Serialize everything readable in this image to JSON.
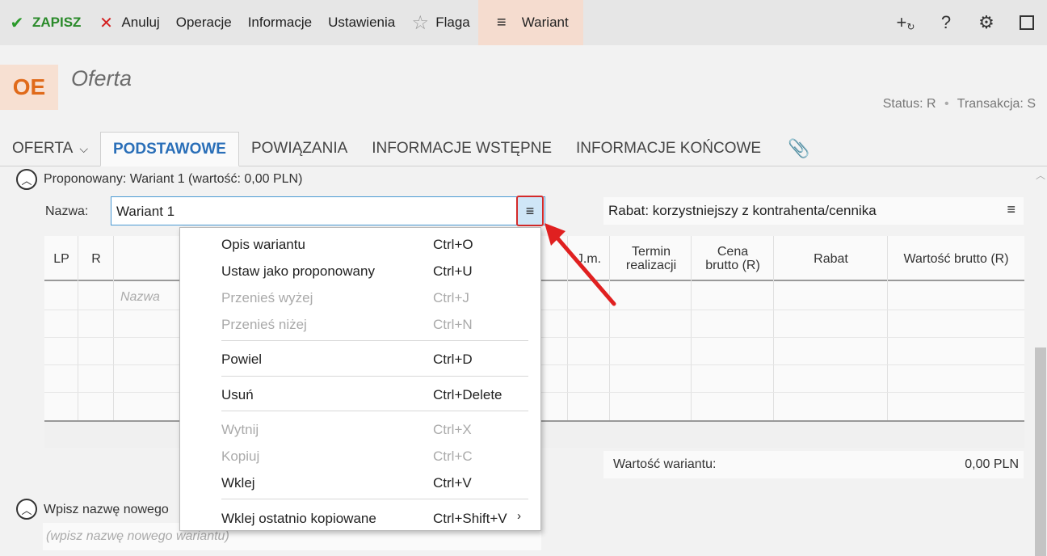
{
  "toolbar": {
    "save": "ZAPISZ",
    "cancel": "Anuluj",
    "operations": "Operacje",
    "info": "Informacje",
    "settings": "Ustawienia",
    "flag": "Flaga",
    "variant": "Wariant",
    "icons": [
      "check-icon",
      "x-icon",
      "star-icon",
      "hamburger-icon",
      "add-refresh-icon",
      "help-icon",
      "gear-icon",
      "maximize-icon"
    ]
  },
  "header": {
    "badge": "OE",
    "title": "Oferta",
    "status_label": "Status:",
    "status_value": "R",
    "transaction_label": "Transakcja:",
    "transaction_value": "S"
  },
  "tabs": [
    "OFERTA",
    "PODSTAWOWE",
    "POWIĄZANIA",
    "INFORMACJE WSTĘPNE",
    "INFORMACJE KOŃCOWE"
  ],
  "active_tab": "PODSTAWOWE",
  "section1": {
    "title": "Proponowany: Wariant 1 (wartość: 0,00 PLN)",
    "name_label": "Nazwa:",
    "name_value": "Wariant 1",
    "rabat": "Rabat: korzystniejszy z kontrahenta/cennika",
    "columns": [
      "LP",
      "R",
      "J.m.",
      "Termin realizacji",
      "Cena brutto (R)",
      "Rabat",
      "Wartość brutto (R)"
    ],
    "name_placeholder": "Nazwa",
    "sum_label": "Wartość wariantu:",
    "sum_value": "0,00 PLN"
  },
  "section2": {
    "title": "Wpisz nazwę nowego",
    "placeholder": "(wpisz nazwę nowego wariantu)"
  },
  "menu": {
    "items": [
      {
        "label": "Opis wariantu",
        "key": "Ctrl+O",
        "enabled": true
      },
      {
        "label": "Ustaw jako proponowany",
        "key": "Ctrl+U",
        "enabled": true
      },
      {
        "label": "Przenieś wyżej",
        "key": "Ctrl+J",
        "enabled": false
      },
      {
        "label": "Przenieś niżej",
        "key": "Ctrl+N",
        "enabled": false
      },
      {
        "label": "Powiel",
        "key": "Ctrl+D",
        "enabled": true
      },
      {
        "label": "Usuń",
        "key": "Ctrl+Delete",
        "enabled": true
      },
      {
        "label": "Wytnij",
        "key": "Ctrl+X",
        "enabled": false
      },
      {
        "label": "Kopiuj",
        "key": "Ctrl+C",
        "enabled": false
      },
      {
        "label": "Wklej",
        "key": "Ctrl+V",
        "enabled": true
      },
      {
        "label": "Wklej ostatnio kopiowane",
        "key": "Ctrl+Shift+V",
        "enabled": true
      }
    ]
  }
}
